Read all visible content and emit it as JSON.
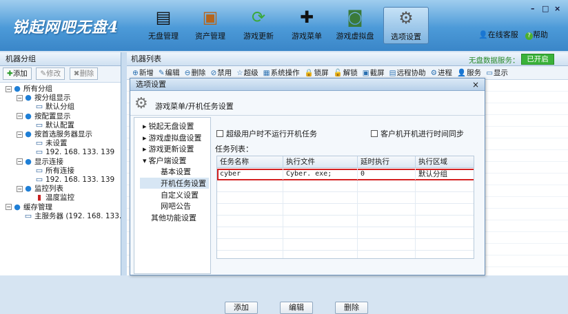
{
  "app": {
    "logo": "锐起网吧无盘4"
  },
  "toolbar": [
    {
      "label": "无盘管理",
      "icon": "hard-disk-icon"
    },
    {
      "label": "资产管理",
      "icon": "briefcase-icon"
    },
    {
      "label": "游戏更新",
      "icon": "refresh-arrows-icon"
    },
    {
      "label": "游戏菜单",
      "icon": "gamepad-icon"
    },
    {
      "label": "游戏虚拟盘",
      "icon": "virtual-disk-icon"
    },
    {
      "label": "选项设置",
      "icon": "gear-icon",
      "active": true
    }
  ],
  "header_links": {
    "support": "在线客服",
    "help": "帮助"
  },
  "window_controls": {
    "minimize": "–",
    "maximize": "□",
    "close": "×"
  },
  "left_panel": {
    "title": "机器分组",
    "buttons": {
      "add": "添加",
      "edit": "修改",
      "delete": "删除"
    },
    "tree": [
      {
        "label": "所有分组",
        "level": 0,
        "toggle": "−",
        "icon": "globe-icon"
      },
      {
        "label": "按分组显示",
        "level": 1,
        "toggle": "−",
        "icon": "globe-icon"
      },
      {
        "label": "默认分组",
        "level": 2,
        "icon": "computer-icon"
      },
      {
        "label": "按配置显示",
        "level": 1,
        "toggle": "−",
        "icon": "globe-icon"
      },
      {
        "label": "默认配置",
        "level": 2,
        "icon": "computer-icon"
      },
      {
        "label": "按首选服务器显示",
        "level": 1,
        "toggle": "−",
        "icon": "globe-icon"
      },
      {
        "label": "未设置",
        "level": 2,
        "icon": "computer-icon"
      },
      {
        "label": "192. 168. 133. 139",
        "level": 2,
        "icon": "computer-icon"
      },
      {
        "label": "显示连接",
        "level": 1,
        "toggle": "−",
        "icon": "globe-icon"
      },
      {
        "label": "所有连接",
        "level": 2,
        "icon": "computer-icon"
      },
      {
        "label": "192. 168. 133. 139",
        "level": 2,
        "icon": "computer-icon"
      },
      {
        "label": "监控列表",
        "level": 1,
        "toggle": "−",
        "icon": "globe-icon"
      },
      {
        "label": "温度监控",
        "level": 2,
        "icon": "thermometer-icon"
      },
      {
        "label": "缓存管理",
        "level": 0,
        "toggle": "−",
        "icon": "globe-icon"
      },
      {
        "label": "主服务器 (192. 168. 133. 139",
        "level": 1,
        "icon": "computer-icon"
      }
    ]
  },
  "right_panel": {
    "title": "机器列表",
    "status_label": "无盘数据服务：",
    "status_button": "已开启",
    "toolbar": [
      "新增",
      "编辑",
      "删除",
      "禁用",
      "超级",
      "系统操作",
      "锁屏",
      "解锁",
      "截屏",
      "远程协助",
      "进程",
      "服务",
      "显示"
    ]
  },
  "dialog": {
    "title": "选项设置",
    "close": "×",
    "heading": "游戏菜单/开机任务设置",
    "nav": [
      {
        "label": "锐起无盘设置",
        "arrow": "▸"
      },
      {
        "label": "游戏虚拟盘设置",
        "arrow": "▸"
      },
      {
        "label": "游戏更新设置",
        "arrow": "▸"
      },
      {
        "label": "客户端设置",
        "arrow": "▾"
      },
      {
        "label": "基本设置"
      },
      {
        "label": "开机任务设置",
        "selected": true
      },
      {
        "label": "自定义设置"
      },
      {
        "label": "网吧公告"
      },
      {
        "label": "其他功能设置"
      }
    ],
    "checkbox_superuser": "超级用户时不运行开机任务",
    "checkbox_sync": "客户机开机进行时间同步",
    "task_list_label": "任务列表：",
    "columns": [
      "任务名称",
      "执行文件",
      "延时执行",
      "执行区域"
    ],
    "rows": [
      {
        "name": "cyber",
        "file": "Cyber. exe;",
        "delay": "0",
        "area": "默认分组"
      }
    ],
    "buttons": {
      "add": "添加",
      "edit": "编辑",
      "delete": "删除"
    }
  }
}
